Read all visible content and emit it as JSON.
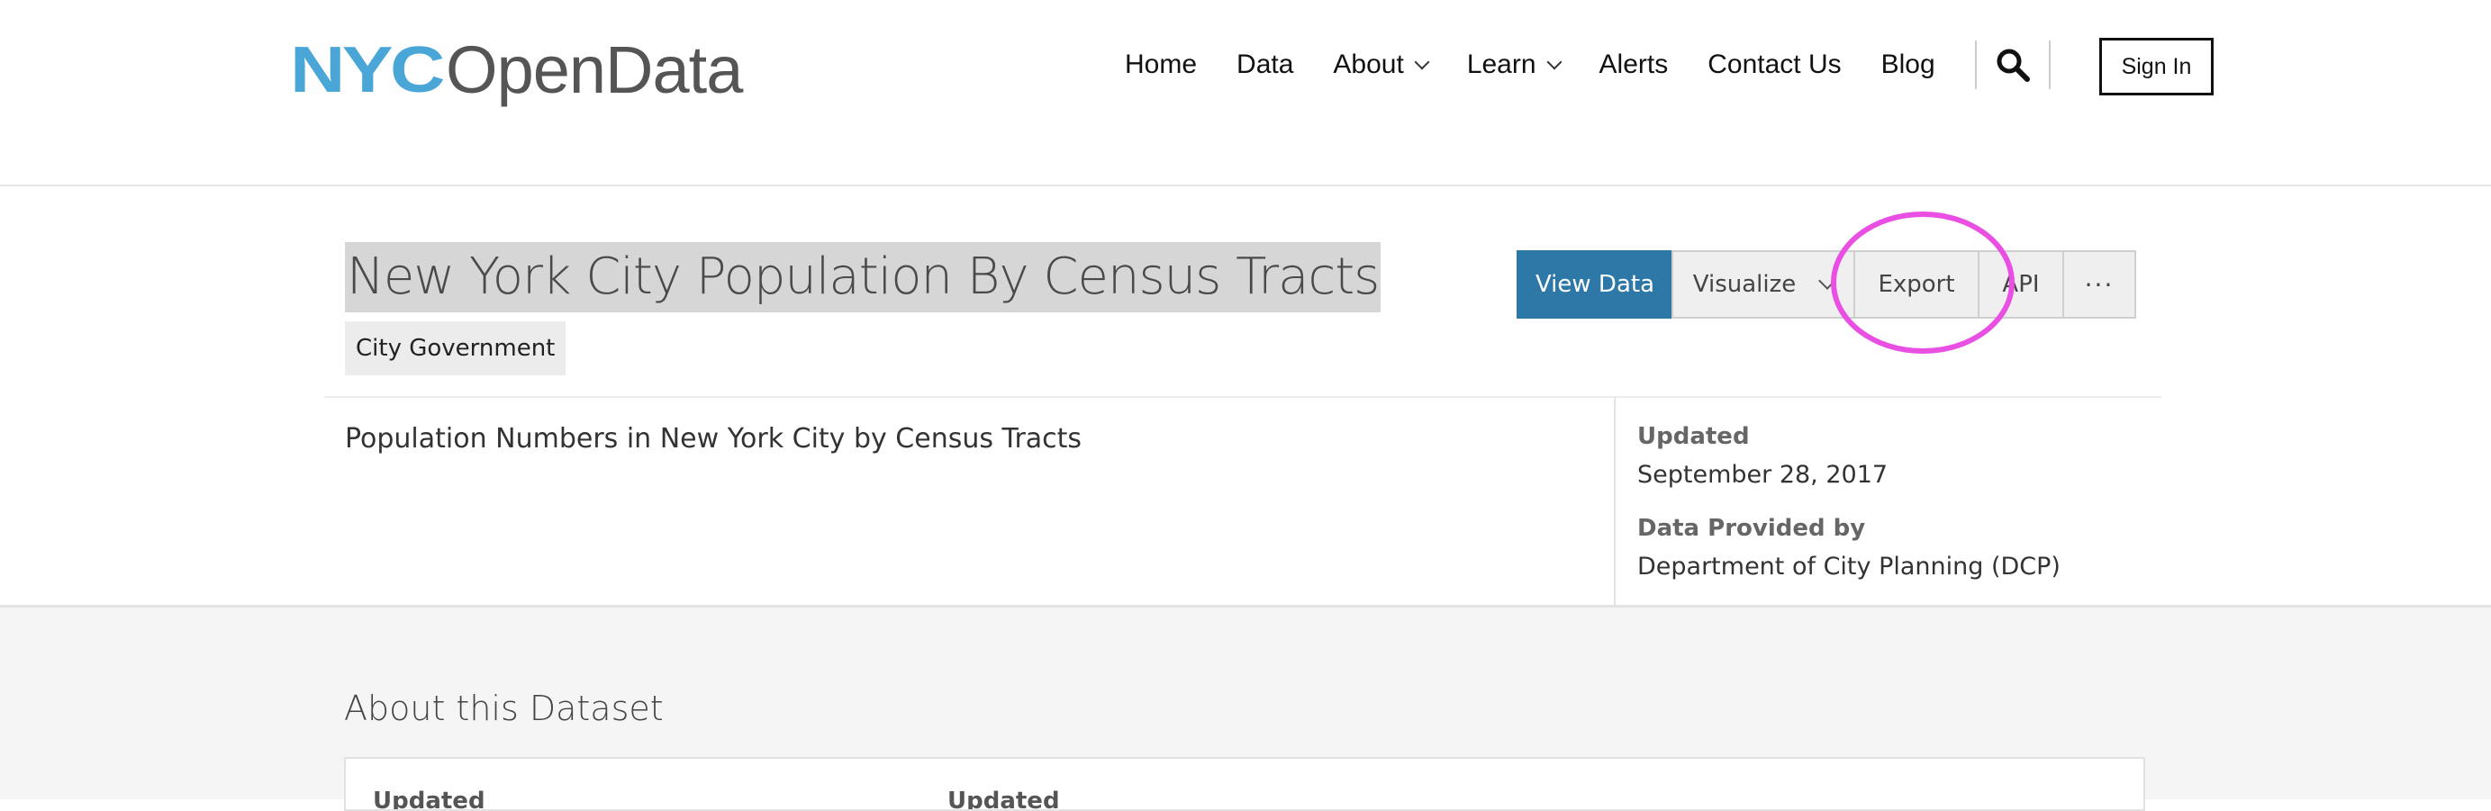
{
  "header": {
    "logo": {
      "mark": "NYC",
      "wordmark": "OpenData"
    },
    "nav": [
      {
        "label": "Home",
        "dropdown": false
      },
      {
        "label": "Data",
        "dropdown": false
      },
      {
        "label": "About",
        "dropdown": true
      },
      {
        "label": "Learn",
        "dropdown": true
      },
      {
        "label": "Alerts",
        "dropdown": false
      },
      {
        "label": "Contact Us",
        "dropdown": false
      },
      {
        "label": "Blog",
        "dropdown": false
      }
    ],
    "search_icon": "search-icon",
    "sign_in_label": "Sign In"
  },
  "dataset": {
    "title": "New York City Population By Census Tracts",
    "category": "City Government",
    "description": "Population Numbers in New York City by Census Tracts",
    "actions": {
      "view_data": "View Data",
      "visualize": "Visualize",
      "export": "Export",
      "api": "API",
      "more": "···"
    },
    "meta": {
      "updated_label": "Updated",
      "updated_value": "September 28, 2017",
      "provider_label": "Data Provided by",
      "provider_value": "Department of City Planning (DCP)"
    }
  },
  "about": {
    "title": "About this Dataset",
    "card_labels": [
      "Updated",
      "Updated"
    ]
  },
  "colors": {
    "brand_blue": "#4ba6d8",
    "primary_button": "#2d78a7",
    "annotation_circle": "#ea4fe4"
  }
}
